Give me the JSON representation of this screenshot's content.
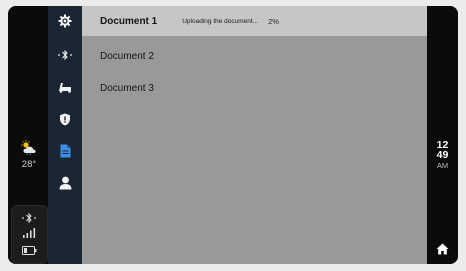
{
  "left_status": {
    "weather_icon": "partly-cloudy-icon",
    "temperature": "28",
    "temperature_unit": "°",
    "bluetooth_icon": "bluetooth-icon",
    "signal_icon": "signal-bars-icon",
    "battery_icon": "battery-icon"
  },
  "nav_rail": {
    "items": [
      {
        "icon": "settings-gear-icon",
        "active": false
      },
      {
        "icon": "bluetooth-icon",
        "active": false
      },
      {
        "icon": "scooter-icon",
        "active": false
      },
      {
        "icon": "shield-icon",
        "active": false
      },
      {
        "icon": "document-icon",
        "active": true
      },
      {
        "icon": "user-icon",
        "active": false
      }
    ]
  },
  "documents": {
    "items": [
      {
        "name": "Document 1",
        "status": "Uploading the document...",
        "progress": "2%",
        "progress_value": 0.02,
        "selected": true
      },
      {
        "name": "Document 2",
        "selected": false
      },
      {
        "name": "Document 3",
        "selected": false
      }
    ]
  },
  "right_status": {
    "hour": "12",
    "minute": "49",
    "ampm": "AM",
    "home_icon": "home-icon"
  },
  "colors": {
    "rail_bg": "#1a2633",
    "active_icon": "#3d8ee6",
    "panel_bg": "#999999",
    "selected_row": "#c6c6c6"
  }
}
